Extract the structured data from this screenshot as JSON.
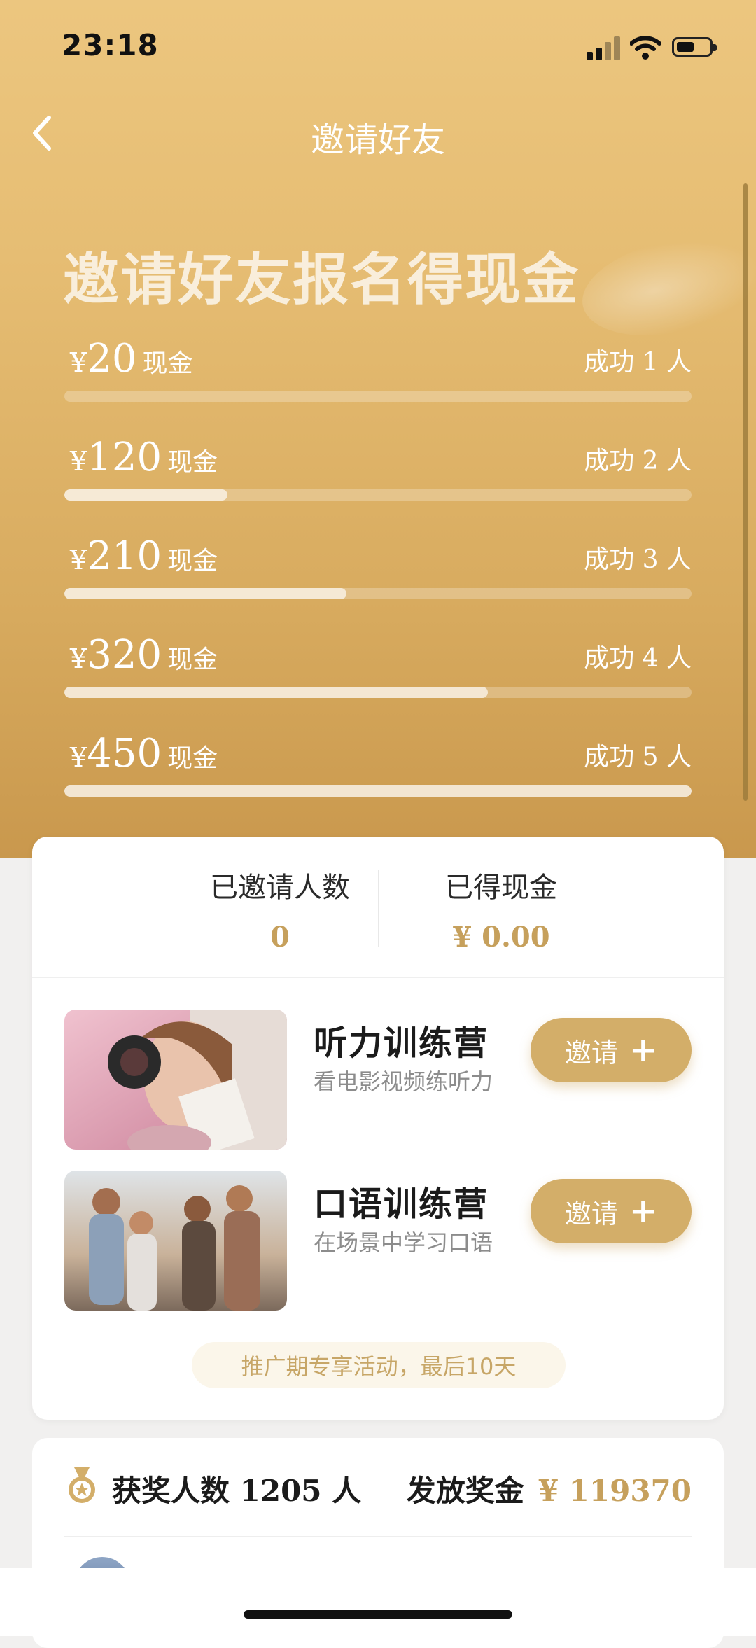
{
  "status_bar": {
    "time": "23:18"
  },
  "nav": {
    "title": "邀请好友"
  },
  "hero": {
    "headline": "邀请好友报名得现金",
    "tiers": [
      {
        "currency": "¥",
        "amount": "20",
        "unit": "现金",
        "condition": "成功 1 人",
        "progress": 0
      },
      {
        "currency": "¥",
        "amount": "120",
        "unit": "现金",
        "condition": "成功 2 人",
        "progress": 0.26
      },
      {
        "currency": "¥",
        "amount": "210",
        "unit": "现金",
        "condition": "成功 3 人",
        "progress": 0.45
      },
      {
        "currency": "¥",
        "amount": "320",
        "unit": "现金",
        "condition": "成功 4 人",
        "progress": 0.675
      },
      {
        "currency": "¥",
        "amount": "450",
        "unit": "现金",
        "condition": "成功 5 人",
        "progress": 1.0
      }
    ]
  },
  "stats": {
    "invited_label": "已邀请人数",
    "invited_value": "0",
    "cash_label": "已得现金",
    "cash_value": "¥ 0.00"
  },
  "courses": [
    {
      "title": "听力训练营",
      "subtitle": "看电影视频练听力",
      "button": "邀请",
      "image": "woman-headphones-photo"
    },
    {
      "title": "口语训练营",
      "subtitle": "在场景中学习口语",
      "button": "邀请",
      "image": "friends-group-photo"
    }
  ],
  "promo": "推广期专享活动，最后10天",
  "summary": {
    "winners_label": "获奖人数 1205 人",
    "bonus_label": "发放奖金",
    "bonus_value": "¥ 119370"
  },
  "icons": [
    "chevron-left-icon",
    "signal-icon",
    "wifi-icon",
    "battery-icon",
    "medal-icon",
    "plus-icon"
  ],
  "colors": {
    "gold": "#d3ae69",
    "gold_text": "#c6a05c",
    "promo_bg": "#fbf6ea"
  }
}
